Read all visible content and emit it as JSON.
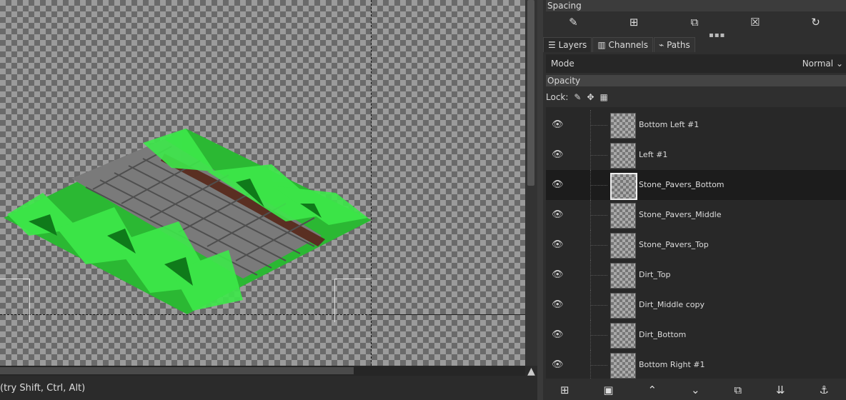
{
  "status_text": "(try Shift, Ctrl, Alt)",
  "navigate_icon": "navigate-icon",
  "right_panel": {
    "spacing_label": "Spacing",
    "brush_tools": [
      "edit-brush-icon",
      "new-brush-icon",
      "duplicate-brush-icon",
      "delete-brush-icon",
      "refresh-brushes-icon"
    ],
    "tabs": [
      {
        "label": "Layers",
        "icon": "layers-icon"
      },
      {
        "label": "Channels",
        "icon": "channels-icon"
      },
      {
        "label": "Paths",
        "icon": "paths-icon"
      }
    ],
    "mode_label": "Mode",
    "mode_value": "Normal",
    "opacity_label": "Opacity",
    "lock_label": "Lock:",
    "layers": [
      {
        "name": "Bottom Left #1",
        "selected": false
      },
      {
        "name": "Left #1",
        "selected": false
      },
      {
        "name": "Stone_Pavers_Bottom",
        "selected": true
      },
      {
        "name": "Stone_Pavers_Middle",
        "selected": false
      },
      {
        "name": "Stone_Pavers_Top",
        "selected": false
      },
      {
        "name": "Dirt_Top",
        "selected": false
      },
      {
        "name": "Dirt_Middle copy",
        "selected": false
      },
      {
        "name": "Dirt_Bottom",
        "selected": false
      },
      {
        "name": "Bottom Right #1",
        "selected": false
      }
    ],
    "bottom_tools": [
      "new-layer-icon",
      "new-layer-group-icon",
      "raise-layer-icon",
      "lower-layer-icon",
      "duplicate-layer-icon",
      "merge-down-icon",
      "anchor-layer-icon"
    ]
  },
  "colors": {
    "grass": "#2fd63a",
    "pavers": "#8a8a8a",
    "dirt": "#5a2f22"
  }
}
